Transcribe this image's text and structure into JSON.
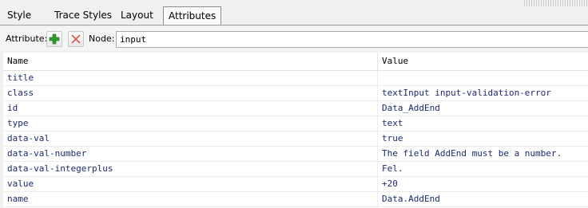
{
  "tabs": [
    {
      "label": "Style",
      "active": false
    },
    {
      "label": "Trace Styles",
      "active": false
    },
    {
      "label": "Layout",
      "active": false
    },
    {
      "label": "Attributes",
      "active": true
    }
  ],
  "toolbar": {
    "attribute_label": "Attribute:",
    "add_icon": "plus-icon",
    "remove_icon": "x-icon",
    "node_label": "Node:",
    "node_value": "input"
  },
  "grid": {
    "columns": [
      "Name",
      "Value"
    ],
    "rows": [
      {
        "name": "title",
        "value": ""
      },
      {
        "name": "class",
        "value": "textInput input-validation-error"
      },
      {
        "name": "id",
        "value": "Data_AddEnd"
      },
      {
        "name": "type",
        "value": "text"
      },
      {
        "name": "data-val",
        "value": "true"
      },
      {
        "name": "data-val-number",
        "value": "The field AddEnd must be a number."
      },
      {
        "name": "data-val-integerplus",
        "value": "Fel."
      },
      {
        "name": "value",
        "value": "+20"
      },
      {
        "name": "name",
        "value": "Data.AddEnd"
      }
    ]
  },
  "colors": {
    "add_icon": "#2ea02e",
    "remove_icon": "#d9534f",
    "cell_text": "#1c2a6e"
  }
}
